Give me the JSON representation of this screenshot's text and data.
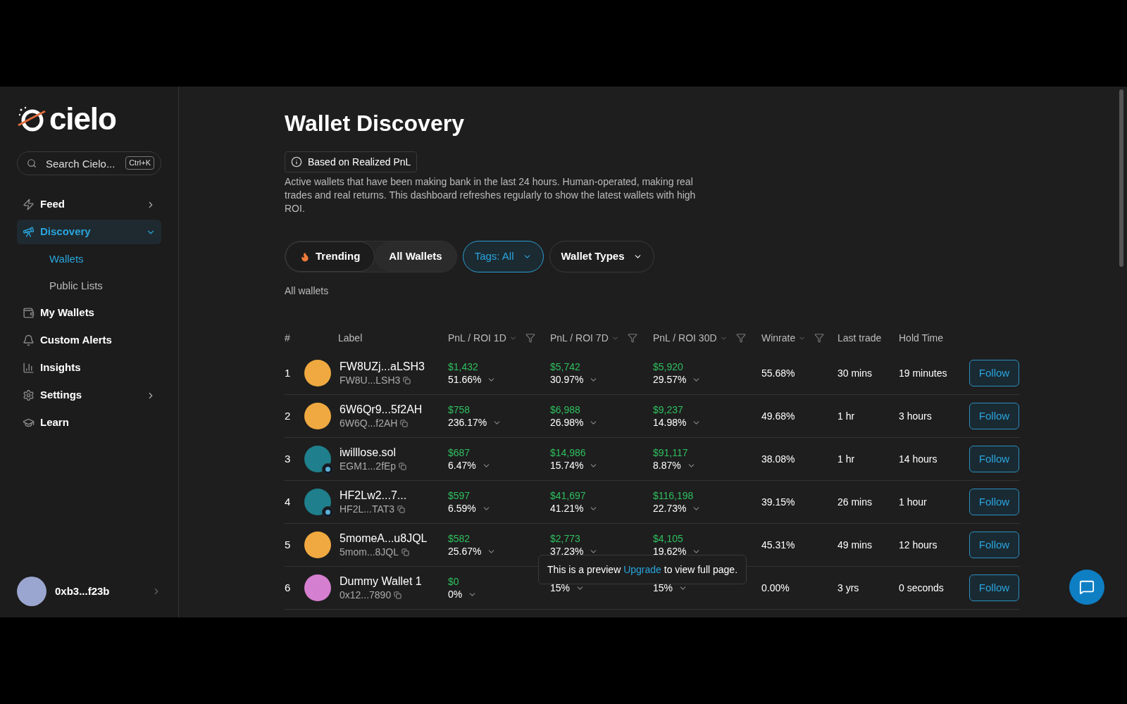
{
  "sidebar": {
    "logo": "cielo",
    "search": {
      "placeholder": "Search Cielo...",
      "shortcut": "Ctrl+K"
    },
    "items": [
      {
        "label": "Feed",
        "selected": false,
        "expandable": true,
        "expanded": false
      },
      {
        "label": "Discovery",
        "selected": true,
        "expandable": true,
        "expanded": true,
        "children": [
          {
            "label": "Wallets",
            "selected": true
          },
          {
            "label": "Public Lists",
            "selected": false
          }
        ]
      },
      {
        "label": "My Wallets",
        "selected": false,
        "expandable": false,
        "expanded": false
      },
      {
        "label": "Custom Alerts",
        "selected": false,
        "expandable": false,
        "expanded": false
      },
      {
        "label": "Insights",
        "selected": false,
        "expandable": false,
        "expanded": false
      },
      {
        "label": "Settings",
        "selected": false,
        "expandable": true,
        "expanded": false
      },
      {
        "label": "Learn",
        "selected": false,
        "expandable": false,
        "expanded": false
      }
    ],
    "account": {
      "name": "0xb3...f23b",
      "color": "#9aa6cf"
    }
  },
  "page": {
    "title": "Wallet Discovery",
    "badge": "Based on Realized PnL",
    "description": "Active wallets that have been making bank in the last 24 hours. Human-operated, making real trades and real returns. This dashboard refreshes regularly to show the latest wallets with high ROI.",
    "segments": [
      {
        "label": "Trending",
        "selected": false
      },
      {
        "label": "All Wallets",
        "selected": true
      }
    ],
    "dropdowns": [
      {
        "label": "Tags: All",
        "active": true
      },
      {
        "label": "Wallet Types",
        "active": false
      }
    ],
    "caption": "All wallets"
  },
  "table": {
    "columns": [
      {
        "label": "#",
        "sortable": false,
        "filter": false
      },
      {
        "label": "Label",
        "sortable": false,
        "filter": false
      },
      {
        "label": "PnL / ROI 1D",
        "sortable": true,
        "filter": true
      },
      {
        "label": "PnL / ROI 7D",
        "sortable": true,
        "filter": true
      },
      {
        "label": "PnL / ROI 30D",
        "sortable": true,
        "filter": true
      },
      {
        "label": "Winrate",
        "sortable": true,
        "filter": true
      },
      {
        "label": "Last trade",
        "sortable": false,
        "filter": false
      },
      {
        "label": "Hold Time",
        "sortable": false,
        "filter": false
      }
    ],
    "rows": [
      {
        "rank": "1",
        "name": "FW8UZj...aLSH3",
        "address": "FW8U...LSH3",
        "color": "#f0a940",
        "badge": false,
        "pnl": [
          {
            "amount": "$1,432",
            "roi": "51.66%"
          },
          {
            "amount": "$5,742",
            "roi": "30.97%"
          },
          {
            "amount": "$5,920",
            "roi": "29.57%"
          }
        ],
        "winrate": "55.68%",
        "last_trade": "30 mins",
        "hold_time": "19 minutes",
        "action": "Follow"
      },
      {
        "rank": "2",
        "name": "6W6Qr9...5f2AH",
        "address": "6W6Q...f2AH",
        "color": "#f0a940",
        "badge": false,
        "pnl": [
          {
            "amount": "$758",
            "roi": "236.17%"
          },
          {
            "amount": "$6,988",
            "roi": "26.98%"
          },
          {
            "amount": "$9,237",
            "roi": "14.98%"
          }
        ],
        "winrate": "49.68%",
        "last_trade": "1 hr",
        "hold_time": "3 hours",
        "action": "Follow"
      },
      {
        "rank": "3",
        "name": "iwilllose.sol",
        "address": "EGM1...2fEp",
        "color": "#1f7f8c",
        "badge": true,
        "pnl": [
          {
            "amount": "$687",
            "roi": "6.47%"
          },
          {
            "amount": "$14,986",
            "roi": "15.74%"
          },
          {
            "amount": "$91,117",
            "roi": "8.87%"
          }
        ],
        "winrate": "38.08%",
        "last_trade": "1 hr",
        "hold_time": "14 hours",
        "action": "Follow"
      },
      {
        "rank": "4",
        "name": "HF2Lw2...7...",
        "address": "HF2L...TAT3",
        "color": "#1f7f8c",
        "badge": true,
        "pnl": [
          {
            "amount": "$597",
            "roi": "6.59%"
          },
          {
            "amount": "$41,697",
            "roi": "41.21%"
          },
          {
            "amount": "$116,198",
            "roi": "22.73%"
          }
        ],
        "winrate": "39.15%",
        "last_trade": "26 mins",
        "hold_time": "1 hour",
        "action": "Follow"
      },
      {
        "rank": "5",
        "name": "5momeA...u8JQL",
        "address": "5mom...8JQL",
        "color": "#f0a940",
        "badge": false,
        "pnl": [
          {
            "amount": "$582",
            "roi": "25.67%"
          },
          {
            "amount": "$2,773",
            "roi": "37.23%"
          },
          {
            "amount": "$4,105",
            "roi": "19.62%"
          }
        ],
        "winrate": "45.31%",
        "last_trade": "49 mins",
        "hold_time": "12 hours",
        "action": "Follow"
      },
      {
        "rank": "6",
        "name": "Dummy Wallet 1",
        "address": "0x12...7890",
        "color": "#d57fd0",
        "badge": false,
        "pnl": [
          {
            "amount": "$0",
            "roi": "0%"
          },
          {
            "roi": "15%"
          },
          {
            "roi": "15%"
          }
        ],
        "winrate": "0.00%",
        "last_trade": "3 yrs",
        "hold_time": "0 seconds",
        "action": "Follow"
      }
    ]
  },
  "tooltip": {
    "before": "This is a preview",
    "link": "Upgrade",
    "after": "to view full page."
  }
}
